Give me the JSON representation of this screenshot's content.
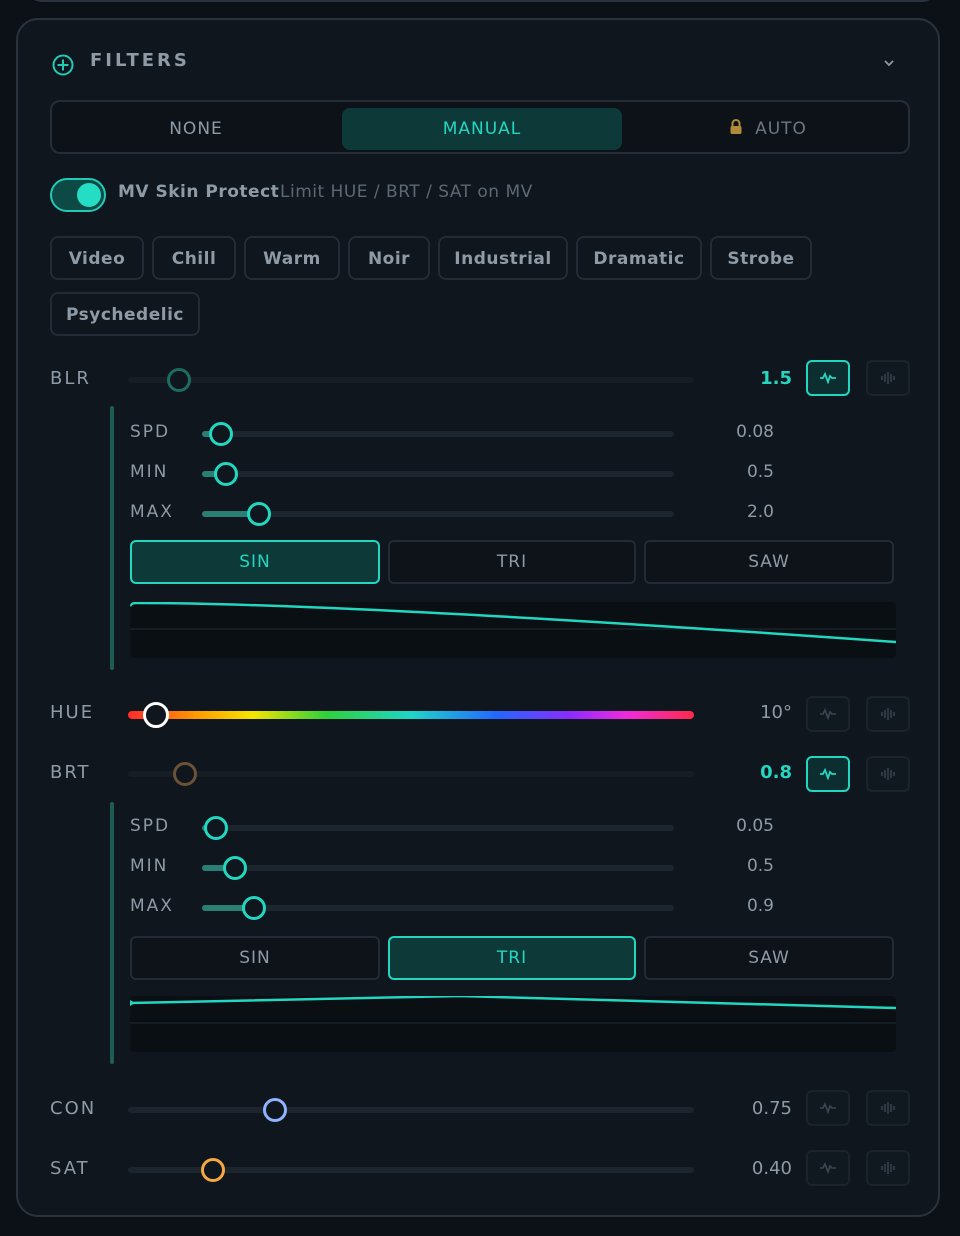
{
  "header": {
    "title": "FILTERS",
    "icon": "plus-circle-icon",
    "collapse_icon": "chevron-down-icon"
  },
  "mode": {
    "options": [
      "NONE",
      "MANUAL",
      "AUTO"
    ],
    "selected": "MANUAL",
    "auto_locked": true
  },
  "skin_protect": {
    "label": "MV Skin Protect",
    "description": "Limit HUE / BRT / SAT on MV",
    "enabled": true
  },
  "presets": [
    "Video",
    "Chill",
    "Warm",
    "Noir",
    "Industrial",
    "Dramatic",
    "Strobe",
    "Psychedelic"
  ],
  "params": {
    "blr": {
      "label": "BLR",
      "value": "1.5",
      "level": 0.09,
      "lfo_active": true,
      "lfo": {
        "spd": {
          "label": "SPD",
          "value": "0.08",
          "level": 0.04
        },
        "min": {
          "label": "MIN",
          "value": "0.5",
          "level": 0.05
        },
        "max": {
          "label": "MAX",
          "value": "2.0",
          "level": 0.12
        },
        "waves": [
          "SIN",
          "TRI",
          "SAW"
        ],
        "selected_wave": "SIN"
      }
    },
    "hue": {
      "label": "HUE",
      "value": "10°",
      "level": 0.05,
      "lfo_active": false
    },
    "brt": {
      "label": "BRT",
      "value": "0.8",
      "level": 0.1,
      "lfo_active": true,
      "lfo": {
        "spd": {
          "label": "SPD",
          "value": "0.05",
          "level": 0.03
        },
        "min": {
          "label": "MIN",
          "value": "0.5",
          "level": 0.07
        },
        "max": {
          "label": "MAX",
          "value": "0.9",
          "level": 0.11
        },
        "waves": [
          "SIN",
          "TRI",
          "SAW"
        ],
        "selected_wave": "TRI"
      }
    },
    "con": {
      "label": "CON",
      "value": "0.75",
      "level": 0.26,
      "lfo_active": false
    },
    "sat": {
      "label": "SAT",
      "value": "0.40",
      "level": 0.15,
      "lfo_active": false
    }
  },
  "colors": {
    "accent": "#22d6c0",
    "con_thumb": "#8fb4ff",
    "sat_thumb": "#f5a742",
    "brt_thumb": "#6b5236"
  },
  "icons": {
    "lfo": "waveform-icon",
    "audio": "audio-bars-icon",
    "lock": "lock-icon"
  }
}
